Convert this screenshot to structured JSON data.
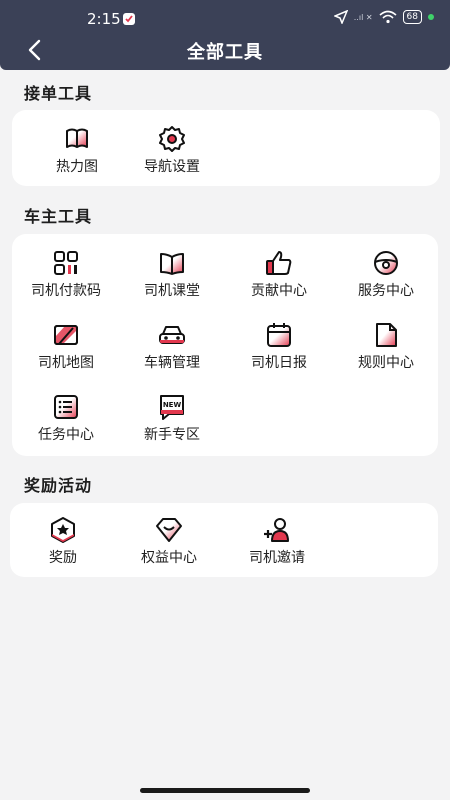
{
  "status_bar": {
    "time": "2:15",
    "signal_text": "..ıl ✕",
    "battery": "68"
  },
  "header": {
    "title": "全部工具"
  },
  "sections": [
    {
      "title": "接单工具",
      "items": [
        {
          "label": "热力图",
          "icon": "map-book-icon"
        },
        {
          "label": "导航设置",
          "icon": "gear-icon"
        }
      ]
    },
    {
      "title": "车主工具",
      "items": [
        {
          "label": "司机付款码",
          "icon": "qr-code-icon"
        },
        {
          "label": "司机课堂",
          "icon": "open-book-icon"
        },
        {
          "label": "贡献中心",
          "icon": "thumbs-up-icon"
        },
        {
          "label": "服务中心",
          "icon": "steering-wheel-icon"
        },
        {
          "label": "司机地图",
          "icon": "map-icon"
        },
        {
          "label": "车辆管理",
          "icon": "car-icon"
        },
        {
          "label": "司机日报",
          "icon": "calendar-icon"
        },
        {
          "label": "规则中心",
          "icon": "document-icon"
        },
        {
          "label": "任务中心",
          "icon": "checklist-icon"
        },
        {
          "label": "新手专区",
          "icon": "new-badge-icon"
        }
      ]
    },
    {
      "title": "奖励活动",
      "items": [
        {
          "label": "奖励",
          "icon": "star-badge-icon"
        },
        {
          "label": "权益中心",
          "icon": "heart-shield-icon"
        },
        {
          "label": "司机邀请",
          "icon": "add-user-icon"
        }
      ]
    }
  ],
  "colors": {
    "header_bg": "#3b4157",
    "accent": "#e2384e",
    "page_bg": "#f3f3f4"
  }
}
